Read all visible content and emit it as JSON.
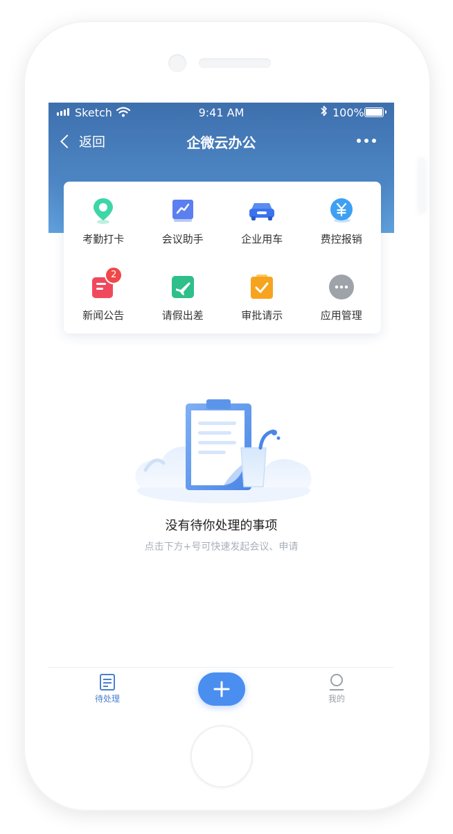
{
  "status_bar": {
    "carrier": "Sketch",
    "time": "9:41 AM",
    "battery": "100%"
  },
  "nav": {
    "back_label": "返回",
    "title": "企微云办公"
  },
  "apps": [
    {
      "label": "考勤打卡",
      "icon": "location-pin-icon"
    },
    {
      "label": "会议助手",
      "icon": "meeting-chart-icon"
    },
    {
      "label": "企业用车",
      "icon": "car-icon"
    },
    {
      "label": "费控报销",
      "icon": "yuan-coin-icon"
    },
    {
      "label": "新闻公告",
      "icon": "news-icon",
      "badge": "2"
    },
    {
      "label": "请假出差",
      "icon": "airplane-icon"
    },
    {
      "label": "审批请示",
      "icon": "approval-check-icon"
    },
    {
      "label": "应用管理",
      "icon": "more-apps-icon"
    }
  ],
  "empty_state": {
    "title": "没有待你处理的事项",
    "subtitle": "点击下方+号可快速发起会议、申请"
  },
  "tabbar": {
    "pending_label": "待处理",
    "mine_label": "我的"
  },
  "colors": {
    "header_top": "#3e6fad",
    "header_bottom": "#5fa0dc",
    "accent": "#4a8ef0",
    "badge": "#f04848"
  }
}
